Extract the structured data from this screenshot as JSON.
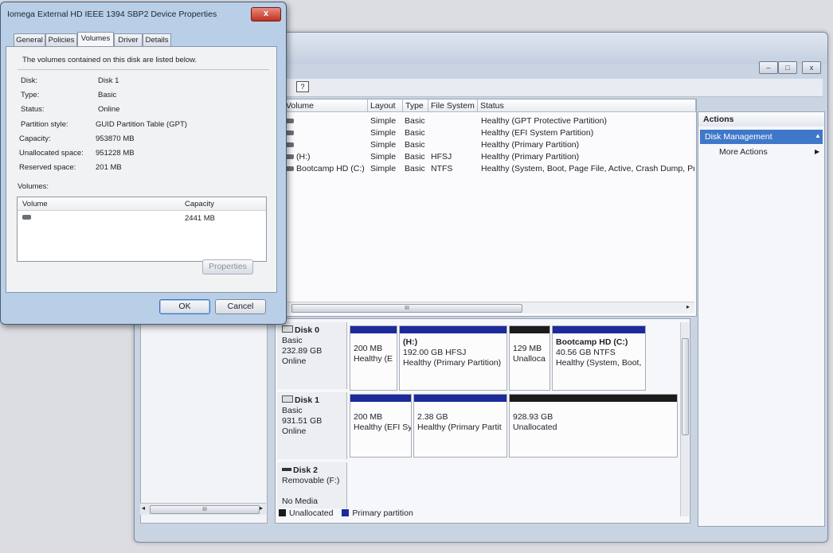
{
  "dialog": {
    "title": "Iomega External HD IEEE 1394 SBP2 Device Properties",
    "close_glyph": "x",
    "tabs": [
      "General",
      "Policies",
      "Volumes",
      "Driver",
      "Details"
    ],
    "active_tab": "Volumes",
    "intro": "The volumes contained on this disk are listed below.",
    "fields": [
      {
        "label": "Disk:",
        "value": "Disk 1"
      },
      {
        "label": "Type:",
        "value": "Basic"
      },
      {
        "label": "Status:",
        "value": "Online"
      },
      {
        "label": "Partition style:",
        "value": "GUID Partition Table (GPT)"
      },
      {
        "label": "Capacity:",
        "value": "953870 MB"
      },
      {
        "label": "Unallocated space:",
        "value": "951228 MB"
      },
      {
        "label": "Reserved space:",
        "value": "201 MB"
      }
    ],
    "volumes_label": "Volumes:",
    "volume_columns": [
      "Volume",
      "Capacity"
    ],
    "volume_rows": [
      {
        "volume": "",
        "capacity": "2441 MB"
      }
    ],
    "properties_button": "Properties",
    "ok_button": "OK",
    "cancel_button": "Cancel"
  },
  "list_view": {
    "columns": [
      "Volume",
      "Layout",
      "Type",
      "File System",
      "Status"
    ],
    "rows": [
      {
        "volume": "",
        "layout": "Simple",
        "type": "Basic",
        "fs": "",
        "status": "Healthy (GPT Protective Partition)"
      },
      {
        "volume": "",
        "layout": "Simple",
        "type": "Basic",
        "fs": "",
        "status": "Healthy (EFI System Partition)"
      },
      {
        "volume": "",
        "layout": "Simple",
        "type": "Basic",
        "fs": "",
        "status": "Healthy (Primary Partition)"
      },
      {
        "volume": "(H:)",
        "layout": "Simple",
        "type": "Basic",
        "fs": "HFSJ",
        "status": "Healthy (Primary Partition)"
      },
      {
        "volume": "Bootcamp HD (C:)",
        "layout": "Simple",
        "type": "Basic",
        "fs": "NTFS",
        "status": "Healthy (System, Boot, Page File, Active, Crash Dump, Prim"
      }
    ],
    "scroll_grip": "III"
  },
  "disks": [
    {
      "name": "Disk 0",
      "type": "Basic",
      "size": "232.89 GB",
      "status": "Online",
      "partitions": [
        {
          "title": "",
          "line1": "200 MB",
          "line2": "Healthy (E",
          "color": "#1c2a9a"
        },
        {
          "title": "(H:)",
          "line1": "192.00 GB HFSJ",
          "line2": "Healthy (Primary Partition)",
          "color": "#1c2a9a"
        },
        {
          "title": "",
          "line1": "129 MB",
          "line2": "Unalloca",
          "color": "#1b1b1b"
        },
        {
          "title": "Bootcamp HD  (C:)",
          "line1": "40.56 GB NTFS",
          "line2": "Healthy (System, Boot,",
          "color": "#1c2a9a"
        }
      ]
    },
    {
      "name": "Disk 1",
      "type": "Basic",
      "size": "931.51 GB",
      "status": "Online",
      "partitions": [
        {
          "title": "",
          "line1": "200 MB",
          "line2": "Healthy (EFI Sy",
          "color": "#1c2a9a"
        },
        {
          "title": "",
          "line1": "2.38 GB",
          "line2": "Healthy (Primary Partit",
          "color": "#1c2a9a"
        },
        {
          "title": "",
          "line1": "928.93 GB",
          "line2": "Unallocated",
          "color": "#1b1b1b"
        }
      ]
    },
    {
      "name": "Disk 2",
      "type": "Removable (F:)",
      "size": "",
      "status": "No Media",
      "partitions": []
    }
  ],
  "legend": {
    "unallocated": "Unallocated",
    "primary": "Primary partition",
    "unallocated_color": "#1b1b1b",
    "primary_color": "#1c2a9a"
  },
  "actions": {
    "header": "Actions",
    "selected": "Disk Management",
    "more": "More Actions"
  },
  "window": {
    "minimize": "–",
    "maximize": "□",
    "close": "x",
    "tree_scroll_grip": "III"
  },
  "icons": [
    "drive-icon",
    "disk-icon",
    "help-icon",
    "scroll-arrow-icon",
    "close-icon"
  ]
}
